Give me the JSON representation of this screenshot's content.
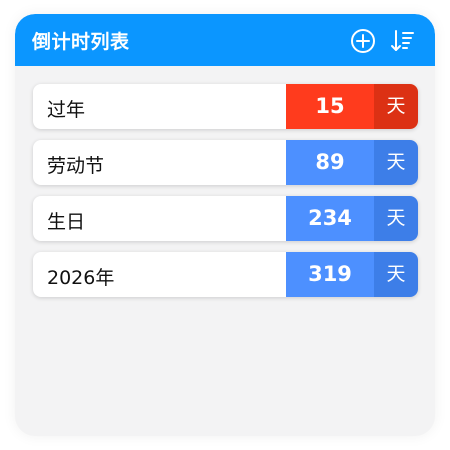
{
  "header": {
    "title": "倒计时列表",
    "add_icon": "plus-circle-icon",
    "sort_icon": "sort-descending-icon"
  },
  "colors": {
    "header_bg": "#0b96ff",
    "urgent_count": "#ff3b1d",
    "urgent_unit": "#dc3114",
    "normal_count": "#4d90ff",
    "normal_unit": "#3d7ee8"
  },
  "countdowns": [
    {
      "name": "过年",
      "days": "15",
      "unit": "天",
      "status": "urgent"
    },
    {
      "name": "劳动节",
      "days": "89",
      "unit": "天",
      "status": "normal"
    },
    {
      "name": "生日",
      "days": "234",
      "unit": "天",
      "status": "normal"
    },
    {
      "name": "2026年",
      "days": "319",
      "unit": "天",
      "status": "normal"
    }
  ]
}
